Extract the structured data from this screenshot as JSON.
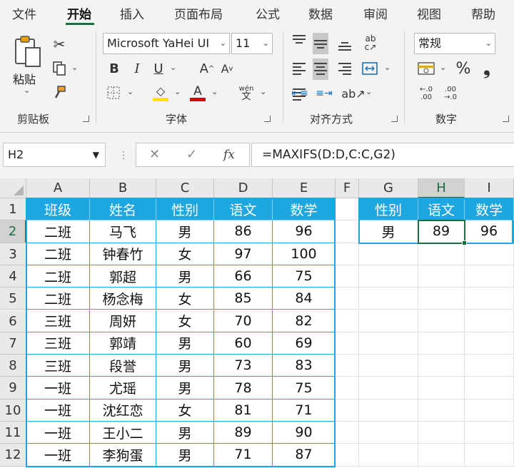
{
  "ribbon": {
    "tabs": [
      {
        "label": "文件",
        "active": false
      },
      {
        "label": "开始",
        "active": true
      },
      {
        "label": "插入",
        "active": false
      },
      {
        "label": "页面布局",
        "active": false
      },
      {
        "label": "公式",
        "active": false
      },
      {
        "label": "数据",
        "active": false
      },
      {
        "label": "审阅",
        "active": false
      },
      {
        "label": "视图",
        "active": false
      },
      {
        "label": "帮助",
        "active": false
      }
    ],
    "clipboard": {
      "group_label": "剪贴板",
      "paste_label": "粘贴"
    },
    "font": {
      "group_label": "字体",
      "font_name": "Microsoft YaHei UI",
      "font_size": "11",
      "bold": "B",
      "italic": "I",
      "underline": "U",
      "grow": "A",
      "shrink": "A",
      "font_color": "A",
      "pinyin": "wén",
      "pinyin_char": "文"
    },
    "alignment": {
      "group_label": "对齐方式"
    },
    "number": {
      "group_label": "数字",
      "format": "常规",
      "percent": "%",
      "comma": "❟",
      "inc_decimal": "←.0 .00",
      "dec_decimal": ".00 →.0"
    },
    "colors": {
      "accent": "#1e6c41",
      "fill_yellow": "#ffe600",
      "font_red": "#e00000"
    }
  },
  "formula_bar": {
    "name_box": "H2",
    "formula": "=MAXIFS(D:D,C:C,G2)"
  },
  "sheet": {
    "active_cell": "H2",
    "columns": [
      "A",
      "B",
      "C",
      "D",
      "E",
      "F",
      "G",
      "H",
      "I"
    ],
    "rows": [
      "1",
      "2",
      "3",
      "4",
      "5",
      "6",
      "7",
      "8",
      "9",
      "10",
      "11",
      "12"
    ],
    "table_headers": [
      "班级",
      "姓名",
      "性别",
      "语文",
      "数学"
    ],
    "table_rows": [
      [
        "二班",
        "马飞",
        "男",
        "86",
        "96"
      ],
      [
        "二班",
        "钟春竹",
        "女",
        "97",
        "100"
      ],
      [
        "二班",
        "郭超",
        "男",
        "66",
        "75"
      ],
      [
        "二班",
        "杨念梅",
        "女",
        "85",
        "84"
      ],
      [
        "三班",
        "周妍",
        "女",
        "70",
        "82"
      ],
      [
        "三班",
        "郭靖",
        "男",
        "60",
        "69"
      ],
      [
        "三班",
        "段誉",
        "男",
        "73",
        "83"
      ],
      [
        "一班",
        "尤瑶",
        "男",
        "78",
        "75"
      ],
      [
        "一班",
        "沈红恋",
        "女",
        "81",
        "71"
      ],
      [
        "一班",
        "王小二",
        "男",
        "89",
        "90"
      ],
      [
        "一班",
        "李狗蛋",
        "男",
        "71",
        "87"
      ]
    ],
    "result_headers": [
      "性别",
      "语文",
      "数学"
    ],
    "result_row": [
      "男",
      "89",
      "96"
    ],
    "colors": {
      "table_header_bg": "#1ea6e0",
      "table_border": "#1ea6e0",
      "selection": "#1e6c41"
    }
  }
}
